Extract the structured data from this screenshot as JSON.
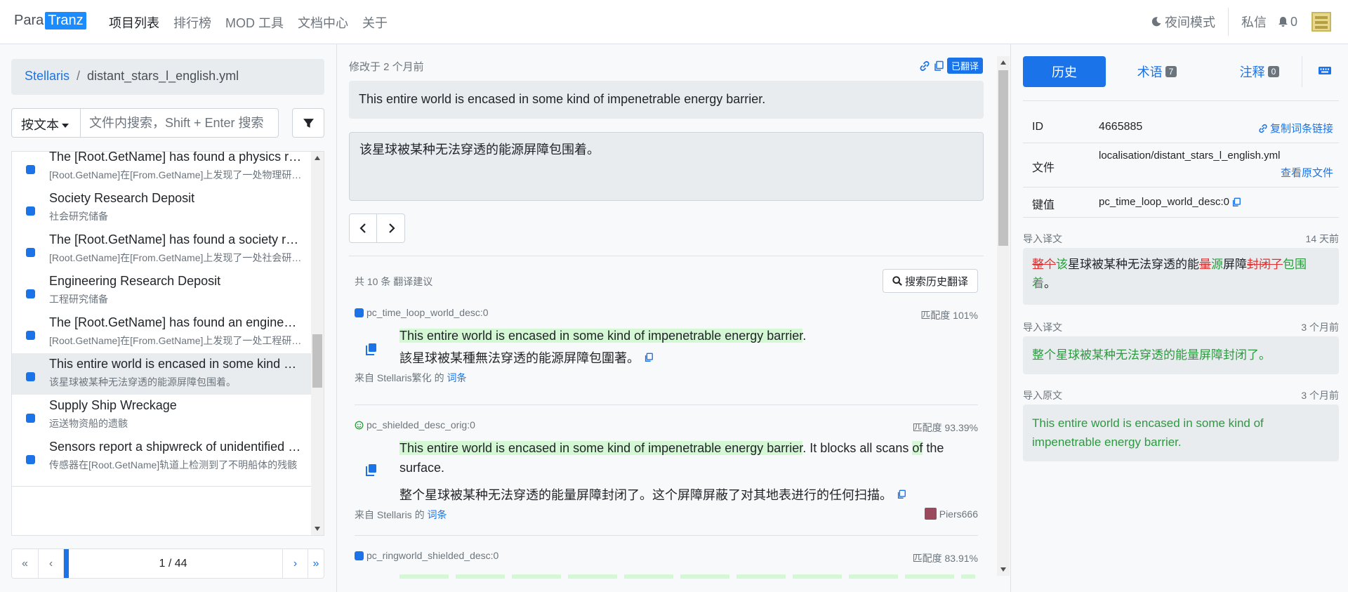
{
  "nav": {
    "logo_left": "Para",
    "logo_right": "Tranz",
    "links": [
      "项目列表",
      "排行榜",
      "MOD 工具",
      "文档中心",
      "关于"
    ],
    "night_mode": "夜间模式",
    "messages": "私信",
    "notifications": "0"
  },
  "left": {
    "breadcrumb_project": "Stellaris",
    "breadcrumb_file": "distant_stars_l_english.yml",
    "search_mode": "按文本",
    "search_placeholder": "文件内搜索，Shift + Enter 搜索",
    "items": [
      {
        "title": "The [Root.GetName] has found a physics research deposit on [From.GetName]",
        "sub": "[Root.GetName]在[From.GetName]上发现了一处物理研究储备"
      },
      {
        "title": "Society Research Deposit",
        "sub": "社会研究储备"
      },
      {
        "title": "The [Root.GetName] has found a society research deposit on [From.GetName]",
        "sub": "[Root.GetName]在[From.GetName]上发现了一处社会研究储备"
      },
      {
        "title": "Engineering Research Deposit",
        "sub": "工程研究储备"
      },
      {
        "title": "The [Root.GetName] has found an engineering research deposit on [From.GetName]",
        "sub": "[Root.GetName]在[From.GetName]上发现了一处工程研究储备"
      },
      {
        "title": "This entire world is encased in some kind of impenetrable energy barrier.",
        "sub": "该星球被某种无法穿透的能源屏障包围着。"
      },
      {
        "title": "Supply Ship Wreckage",
        "sub": "运送物资船的遗骸"
      },
      {
        "title": "Sensors report a shipwreck of unidentified origin in orbit of [Root.GetName]",
        "sub": "传感器在[Root.GetName]轨道上检测到了不明船体的残骸"
      }
    ],
    "pager": {
      "first": "«",
      "prev": "‹",
      "page": "1 / 44",
      "next": "›",
      "last": "»",
      "progress": 0.0227
    }
  },
  "mid": {
    "modified": "修改于 2 个月前",
    "status": "已翻译",
    "source": "This entire world is encased in some kind of impenetrable energy barrier.",
    "translation": "该星球被某种无法穿透的能源屏障包围着。",
    "suggestion_count": "共 10 条 翻译建议",
    "search_history": "搜索历史翻译",
    "suggestions": [
      {
        "key": "pc_time_loop_world_desc:0",
        "match": "匹配度 101%",
        "source_rest": ".",
        "target": "該星球被某種無法穿透的能源屏障包圍著。",
        "from_prefix": "来自 Stellaris繁化 的",
        "from_link": "词条",
        "user": ""
      },
      {
        "key": "pc_shielded_desc_orig:0",
        "match": "匹配度 93.39%",
        "source_rest": ". It blocks all scans ",
        "source_tail": " the surface.",
        "target": "整个星球被某种无法穿透的能量屏障封闭了。这个屏障屏蔽了对其地表进行的任何扫描。",
        "from_prefix": "来自 Stellaris 的",
        "from_link": "词条",
        "user": "Piers666"
      },
      {
        "key": "pc_ringworld_shielded_desc:0",
        "match": "匹配度 83.91%"
      }
    ]
  },
  "right": {
    "tabs": [
      {
        "label": "历史",
        "count": ""
      },
      {
        "label": "术语",
        "count": "7"
      },
      {
        "label": "注释",
        "count": "0"
      }
    ],
    "id_label": "ID",
    "id_value": "4665885",
    "copy_link": "复制词条链接",
    "file_label": "文件",
    "file_value": "localisation/distant_stars_l_english.yml",
    "view_source": "查看原文件",
    "key_label": "键值",
    "key_value": "pc_time_loop_world_desc:0",
    "history": [
      {
        "type": "导入译文",
        "time": "14 天前"
      },
      {
        "type": "导入译文",
        "time": "3 个月前",
        "text": "整个星球被某种无法穿透的能量屏障封闭了。"
      },
      {
        "type": "导入原文",
        "time": "3 个月前",
        "text": "This entire world is encased in some kind of impenetrable energy barrier."
      }
    ],
    "diff": {
      "del1": "整个",
      "ins1": "该",
      "same1": "星球被某种无法穿透的能",
      "del2": "量",
      "ins2": "源",
      "same2": "屏障",
      "del3": "封闭了",
      "ins3": "包围着",
      "same3": "。"
    }
  },
  "colors": {
    "accent": "#1a73e8",
    "highlight": "#d4f7d4",
    "deleted": "#e03131",
    "inserted": "#2b9a3e"
  }
}
